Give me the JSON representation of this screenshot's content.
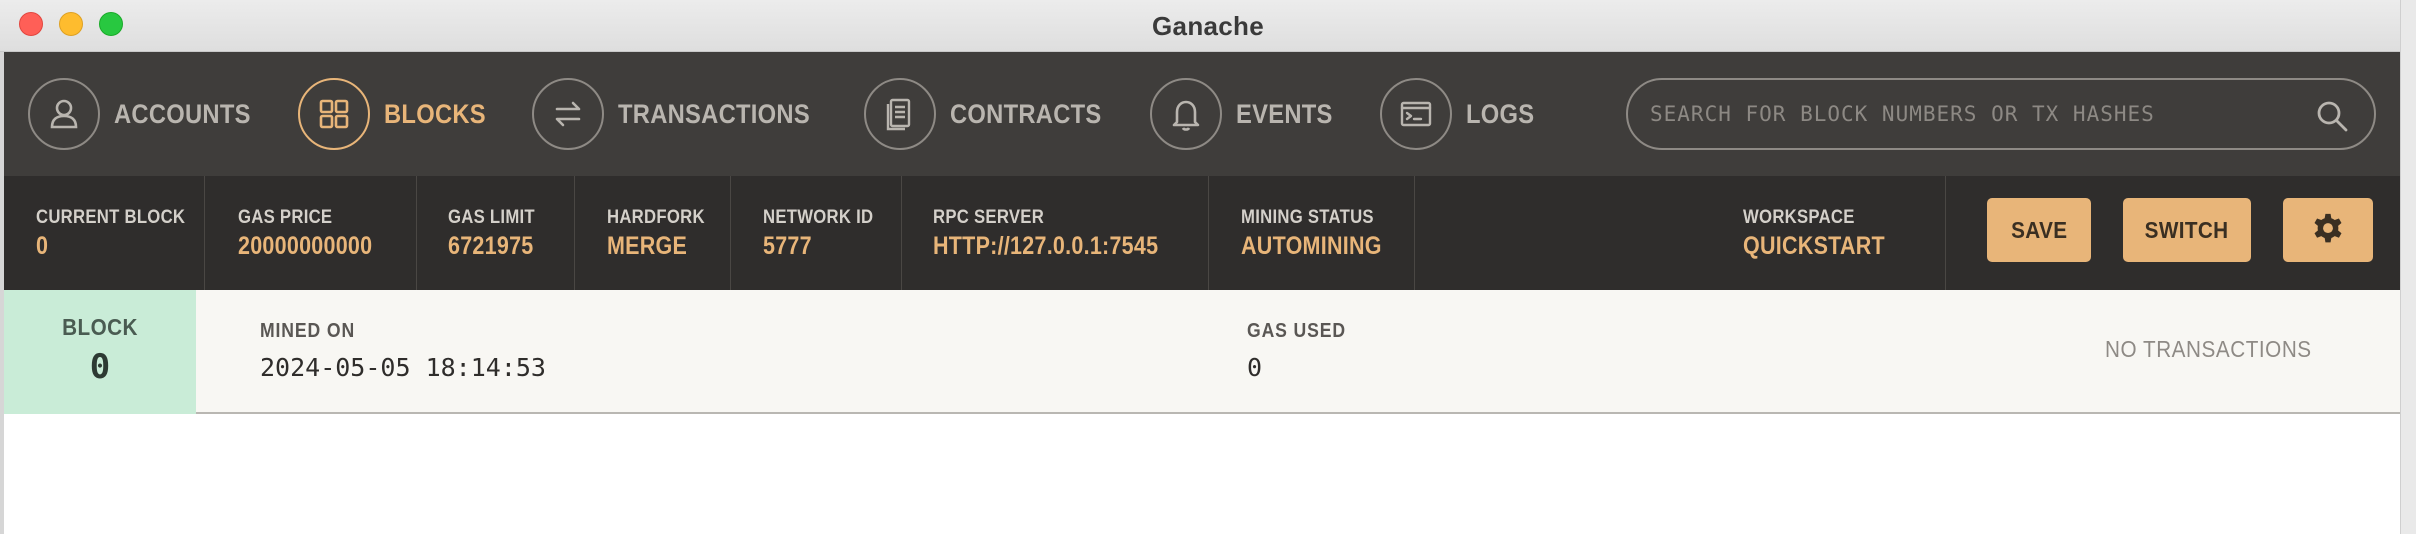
{
  "window": {
    "title": "Ganache"
  },
  "nav": {
    "items": [
      {
        "label": "ACCOUNTS",
        "icon": "user-icon",
        "active": false
      },
      {
        "label": "BLOCKS",
        "icon": "grid-icon",
        "active": true
      },
      {
        "label": "TRANSACTIONS",
        "icon": "arrows-swap-icon",
        "active": false
      },
      {
        "label": "CONTRACTS",
        "icon": "document-icon",
        "active": false
      },
      {
        "label": "EVENTS",
        "icon": "bell-icon",
        "active": false
      },
      {
        "label": "LOGS",
        "icon": "terminal-icon",
        "active": false
      }
    ],
    "search": {
      "placeholder": "SEARCH FOR BLOCK NUMBERS OR TX HASHES",
      "value": ""
    }
  },
  "status": {
    "current_block": {
      "label": "CURRENT BLOCK",
      "value": "0"
    },
    "gas_price": {
      "label": "GAS PRICE",
      "value": "20000000000"
    },
    "gas_limit": {
      "label": "GAS LIMIT",
      "value": "6721975"
    },
    "hardfork": {
      "label": "HARDFORK",
      "value": "MERGE"
    },
    "network_id": {
      "label": "NETWORK ID",
      "value": "5777"
    },
    "rpc_server": {
      "label": "RPC SERVER",
      "value": "HTTP://127.0.0.1:7545"
    },
    "mining_status": {
      "label": "MINING STATUS",
      "value": "AUTOMINING"
    },
    "workspace": {
      "label": "WORKSPACE",
      "value": "QUICKSTART"
    },
    "save_label": "SAVE",
    "switch_label": "SWITCH",
    "settings_icon": "gear-icon"
  },
  "blocks": [
    {
      "badge_label": "BLOCK",
      "number": "0",
      "mined_on_label": "MINED ON",
      "mined_on": "2024-05-05 18:14:53",
      "gas_used_label": "GAS USED",
      "gas_used": "0",
      "tx_summary": "NO TRANSACTIONS"
    }
  ],
  "colors": {
    "accent": "#e8b579",
    "nav_bg": "#3f3d3b",
    "status_bg": "#2f2d2c",
    "block_badge_bg": "#c9ecd7"
  }
}
